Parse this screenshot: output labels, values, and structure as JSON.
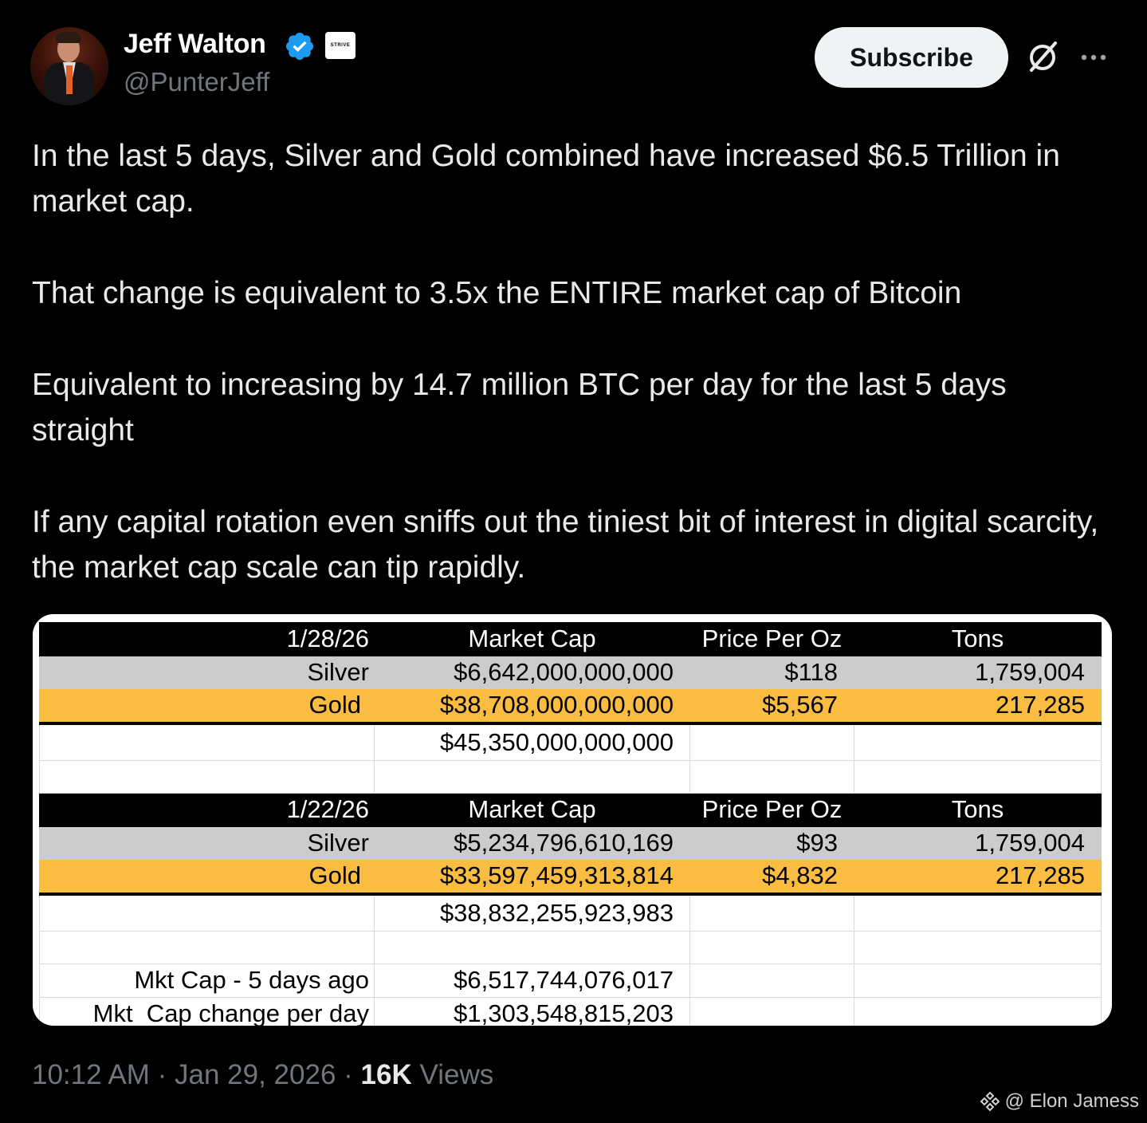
{
  "author": {
    "name": "Jeff Walton",
    "handle": "@PunterJeff",
    "affiliate_badge": "STRIVE"
  },
  "actions": {
    "subscribe_label": "Subscribe"
  },
  "icons": [
    "verified-badge-icon",
    "grok-icon",
    "more-options-icon"
  ],
  "colors": {
    "verified_blue": "#1d9bf0",
    "silver_row": "#cccccc",
    "gold_row": "#fbbc42"
  },
  "post": {
    "paragraphs": [
      "In the last 5 days, Silver and Gold combined have increased $6.5 Trillion in market cap.",
      "That change is equivalent to 3.5x the ENTIRE market cap of Bitcoin",
      "Equivalent to increasing by 14.7 million BTC per day for the last 5 days straight",
      "If any capital rotation even sniffs out the tiniest bit of interest in digital scarcity, the market cap scale can tip rapidly."
    ]
  },
  "table": {
    "block1": {
      "header": [
        "1/28/26",
        "Market Cap",
        "Price Per Oz",
        "Tons"
      ],
      "silver": [
        "Silver",
        "$6,642,000,000,000",
        "$118",
        "1,759,004"
      ],
      "gold": [
        "Gold",
        "$38,708,000,000,000",
        "$5,567",
        "217,285"
      ],
      "total": "$45,350,000,000,000"
    },
    "block2": {
      "header": [
        "1/22/26",
        "Market Cap",
        "Price Per Oz",
        "Tons"
      ],
      "silver": [
        "Silver",
        "$5,234,796,610,169",
        "$93",
        "1,759,004"
      ],
      "gold": [
        "Gold",
        "$33,597,459,313,814",
        "$4,832",
        "217,285"
      ],
      "total": "$38,832,255,923,983"
    },
    "summary": [
      {
        "label": "Mkt Cap - 5 days ago",
        "value": "$6,517,744,076,017"
      },
      {
        "label": "Mkt  Cap change per day",
        "value": "$1,303,548,815,203"
      }
    ]
  },
  "footer": {
    "time": "10:12 AM",
    "date": "Jan 29, 2026",
    "views_count": "16K",
    "views_label": "Views"
  },
  "watermark": "@ Elon Jamess"
}
